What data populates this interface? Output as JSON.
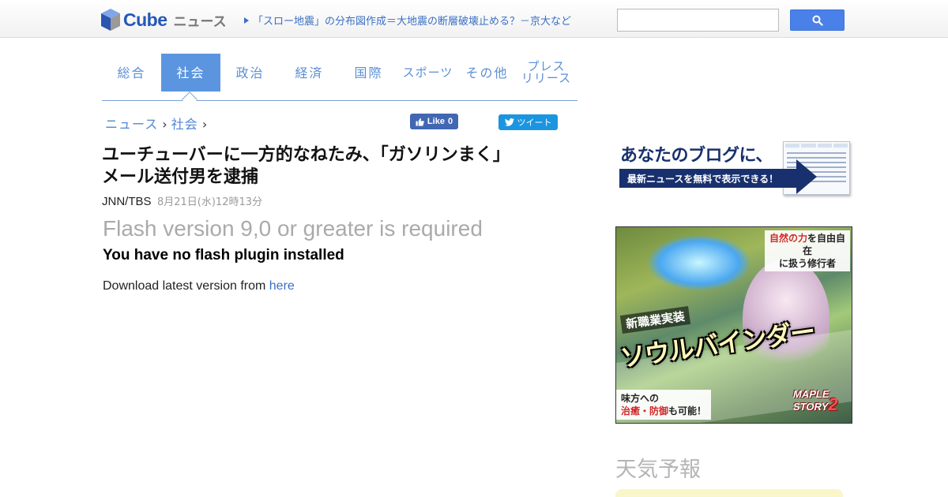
{
  "header": {
    "logo_word": "Cube",
    "logo_sub": "ニュース",
    "ticker": "「スロー地震」の分布図作成＝大地震の断層破壊止める？－京大など",
    "search_placeholder": ""
  },
  "tabs": [
    {
      "label": "総合",
      "active": false
    },
    {
      "label": "社会",
      "active": true
    },
    {
      "label": "政治",
      "active": false
    },
    {
      "label": "経済",
      "active": false
    },
    {
      "label": "国際",
      "active": false
    },
    {
      "label": "スポーツ",
      "active": false
    },
    {
      "label": "その他",
      "active": false
    },
    {
      "label_line1": "プレス",
      "label_line2": "リリース",
      "active": false
    }
  ],
  "breadcrumb": {
    "items": [
      "ニュース",
      "社会"
    ],
    "separator": "›"
  },
  "social": {
    "like_label": "Like",
    "like_count": "0",
    "tweet_label": "ツイート"
  },
  "article": {
    "title_line1": "ユーチューバーに一方的なねたみ、「ガソリンまく」",
    "title_line2": "メール送付男を逮捕",
    "source": "JNN/TBS",
    "date": "8月21日(水)12時13分"
  },
  "flash": {
    "title": "Flash version 9,0 or greater is required",
    "subtitle": "You have no flash plugin installed",
    "download_text": "Download latest version from",
    "download_link": "here"
  },
  "sidebar": {
    "blog_banner": {
      "line1": "あなたのブログに、",
      "line2": "最新ニュースを無料で表示できる！",
      "thumb_tabs": [
        "総合",
        "社会",
        "政治",
        "経済"
      ]
    },
    "game_ad": {
      "tag_red": "自然の力",
      "tag_rest1": "を自由自在",
      "tag_rest2": "に扱う修行者",
      "new_job": "新職業実装",
      "big_title": "ソウルバインダー",
      "bottom_line1": "味方への",
      "bottom_red": "治癒・防御",
      "bottom_rest": "も可能！",
      "logo_line1": "MAPLE",
      "logo_line2": "STORY",
      "logo_num": "2"
    },
    "weather_title": "天気予報"
  },
  "colors": {
    "brand_blue": "#2457b8",
    "link_blue": "#4f86d4",
    "active_tab": "#5b95e0",
    "facebook": "#4267b2",
    "twitter": "#1b95e0",
    "search_button": "#4a81e8"
  }
}
